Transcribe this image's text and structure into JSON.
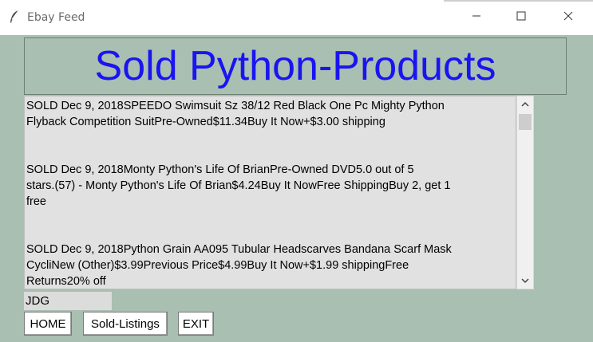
{
  "window": {
    "title": "Ebay Feed",
    "icons": [
      "feather-icon",
      "minimize-icon",
      "maximize-icon",
      "close-icon"
    ]
  },
  "header": {
    "title": "Sold Python-Products",
    "color": "#1a14f0"
  },
  "listbox": {
    "entries": [
      {
        "lines": [
          "SOLD  Dec 9, 2018SPEEDO Swimsuit Sz 38/12 Red Black One Pc Mighty Python",
          "Flyback Competition SuitPre-Owned$11.34Buy It Now+$3.00 shipping"
        ]
      },
      {
        "lines": [
          "SOLD  Dec 9, 2018Monty Python's Life Of BrianPre-Owned  DVD5.0 out of 5",
          "stars.(57) - Monty Python's Life Of Brian$4.24Buy It NowFree ShippingBuy 2, get 1",
          "free"
        ]
      },
      {
        "lines": [
          "SOLD  Dec 9, 2018Python Grain AA095 Tubular Headscarves Bandana Scarf Mask",
          "CycliNew (Other)$3.99Previous Price$4.99Buy It Now+$1.99 shippingFree",
          "Returns20% off"
        ]
      }
    ]
  },
  "status_field": {
    "value": "JDG"
  },
  "buttons": {
    "home": "HOME",
    "sold_listings": "Sold-Listings",
    "exit": "EXIT"
  },
  "colors": {
    "background": "#a8bfb2",
    "listbox": "#e1e1e1"
  }
}
